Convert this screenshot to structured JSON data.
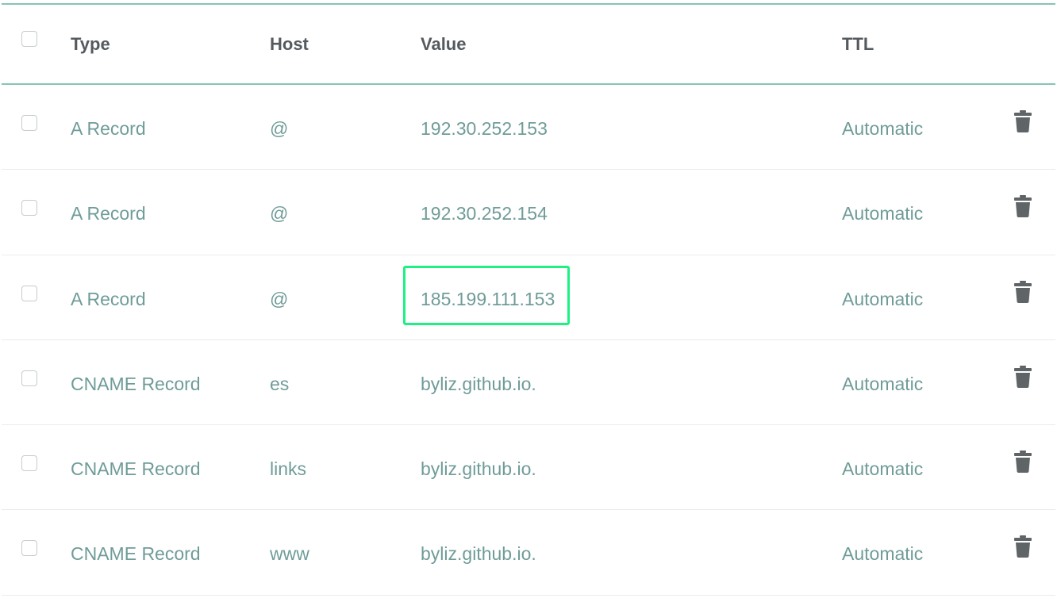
{
  "header": {
    "type_label": "Type",
    "host_label": "Host",
    "value_label": "Value",
    "ttl_label": "TTL"
  },
  "records": [
    {
      "type": "A Record",
      "host": "@",
      "value": "192.30.252.153",
      "ttl": "Automatic"
    },
    {
      "type": "A Record",
      "host": "@",
      "value": "192.30.252.154",
      "ttl": "Automatic"
    },
    {
      "type": "A Record",
      "host": "@",
      "value": "185.199.111.153",
      "ttl": "Automatic",
      "highlighted": true
    },
    {
      "type": "CNAME Record",
      "host": "es",
      "value": "byliz.github.io.",
      "ttl": "Automatic"
    },
    {
      "type": "CNAME Record",
      "host": "links",
      "value": "byliz.github.io.",
      "ttl": "Automatic"
    },
    {
      "type": "CNAME Record",
      "host": "www",
      "value": "byliz.github.io.",
      "ttl": "Automatic"
    }
  ],
  "icons": {
    "row_action": "trash-icon",
    "select": "checkbox"
  },
  "colors": {
    "accent_rule": "#86c5b6",
    "cell_text": "#6f9c98",
    "header_text": "#555a5e",
    "highlight_box": "#1ef184",
    "icon": "#5f6466"
  }
}
